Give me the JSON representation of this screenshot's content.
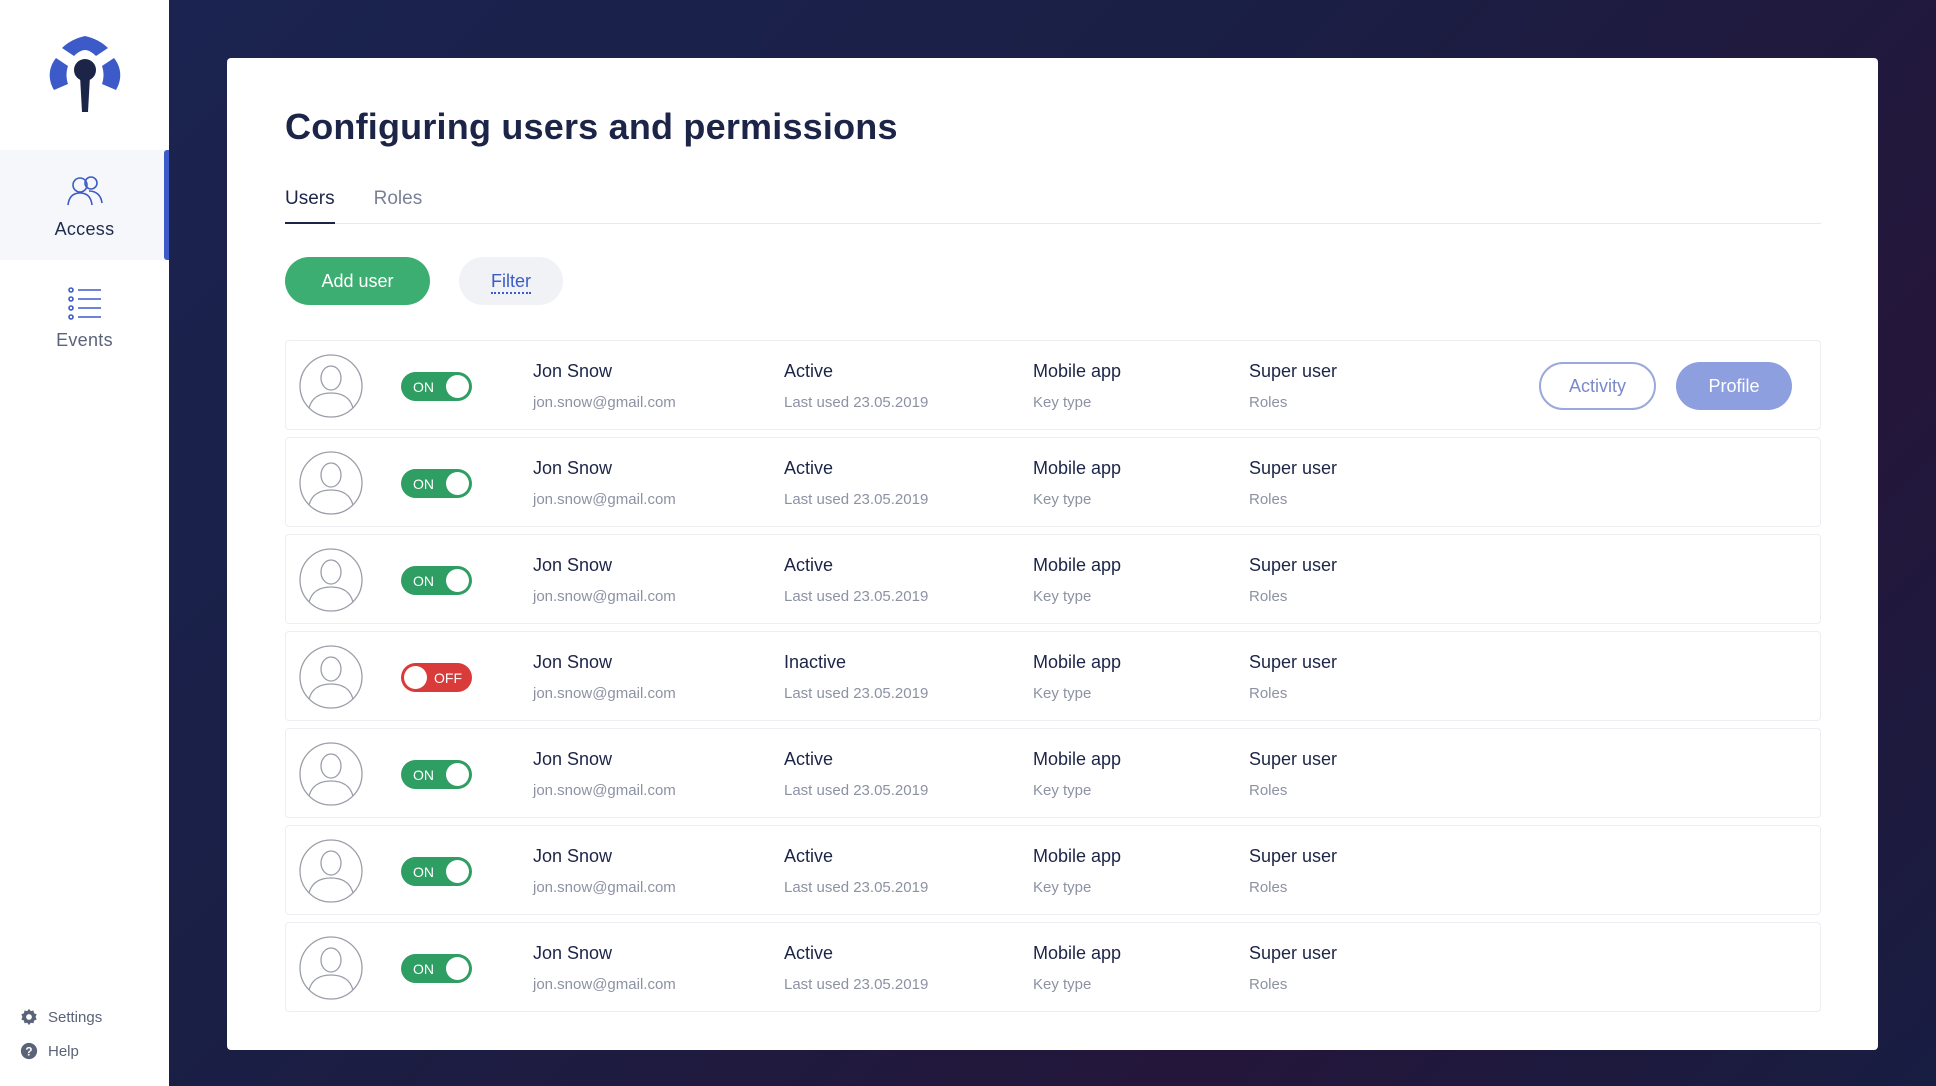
{
  "sidebar": {
    "nav": [
      {
        "label": "Access",
        "icon": "users-icon",
        "active": true
      },
      {
        "label": "Events",
        "icon": "list-icon",
        "active": false
      }
    ],
    "footer": [
      {
        "label": "Settings",
        "icon": "gear-icon"
      },
      {
        "label": "Help",
        "icon": "help-icon"
      }
    ]
  },
  "page": {
    "title": "Configuring users and permissions",
    "tabs": [
      {
        "label": "Users",
        "active": true
      },
      {
        "label": "Roles",
        "active": false
      }
    ],
    "add_user_label": "Add user",
    "filter_label": "Filter"
  },
  "row_actions": {
    "activity_label": "Activity",
    "profile_label": "Profile"
  },
  "users": [
    {
      "toggle": "ON",
      "name": "Jon Snow",
      "email": "jon.snow@gmail.com",
      "status": "Active",
      "last_used": "Last used 23.05.2019",
      "key": "Mobile app",
      "key_label": "Key type",
      "role": "Super user",
      "role_label": "Roles"
    },
    {
      "toggle": "ON",
      "name": "Jon Snow",
      "email": "jon.snow@gmail.com",
      "status": "Active",
      "last_used": "Last used 23.05.2019",
      "key": "Mobile app",
      "key_label": "Key type",
      "role": "Super user",
      "role_label": "Roles"
    },
    {
      "toggle": "ON",
      "name": "Jon Snow",
      "email": "jon.snow@gmail.com",
      "status": "Active",
      "last_used": "Last used 23.05.2019",
      "key": "Mobile app",
      "key_label": "Key type",
      "role": "Super user",
      "role_label": "Roles"
    },
    {
      "toggle": "OFF",
      "name": "Jon Snow",
      "email": "jon.snow@gmail.com",
      "status": "Inactive",
      "last_used": "Last used 23.05.2019",
      "key": "Mobile app",
      "key_label": "Key type",
      "role": "Super user",
      "role_label": "Roles"
    },
    {
      "toggle": "ON",
      "name": "Jon Snow",
      "email": "jon.snow@gmail.com",
      "status": "Active",
      "last_used": "Last used 23.05.2019",
      "key": "Mobile app",
      "key_label": "Key type",
      "role": "Super user",
      "role_label": "Roles"
    },
    {
      "toggle": "ON",
      "name": "Jon Snow",
      "email": "jon.snow@gmail.com",
      "status": "Active",
      "last_used": "Last used 23.05.2019",
      "key": "Mobile app",
      "key_label": "Key type",
      "role": "Super user",
      "role_label": "Roles"
    },
    {
      "toggle": "ON",
      "name": "Jon Snow",
      "email": "jon.snow@gmail.com",
      "status": "Active",
      "last_used": "Last used 23.05.2019",
      "key": "Mobile app",
      "key_label": "Key type",
      "role": "Super user",
      "role_label": "Roles"
    }
  ],
  "colors": {
    "accent_blue": "#3d5bc8",
    "add_green": "#3dae72",
    "toggle_on": "#2f9e63",
    "toggle_off": "#d93a3a",
    "profile_button": "#8e9fe0"
  }
}
